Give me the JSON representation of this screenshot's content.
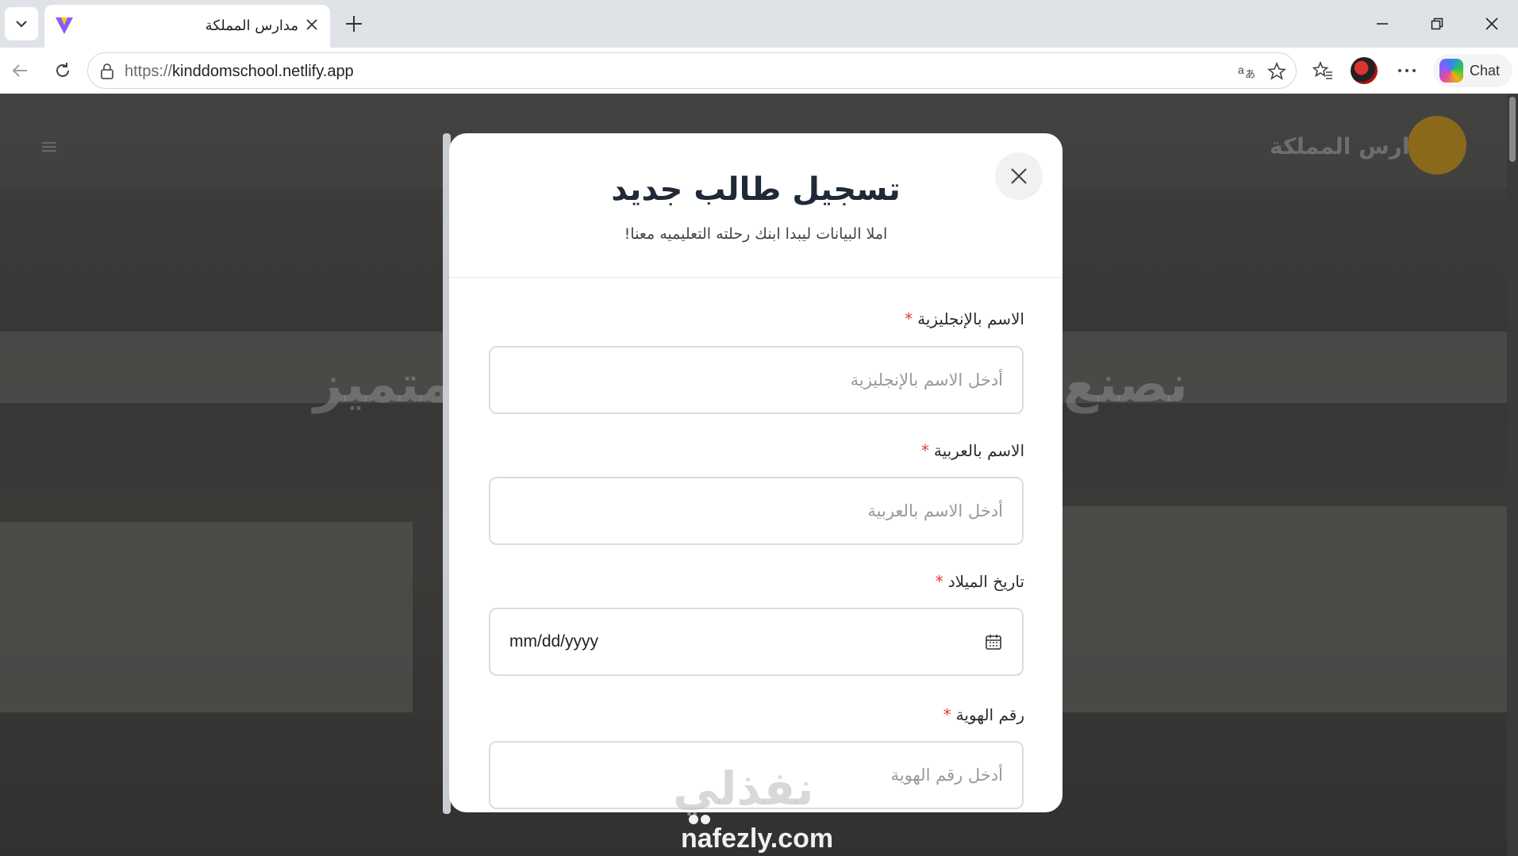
{
  "browser": {
    "tab_title": "مدارس المملكة",
    "url_protocol": "https://",
    "url_host": "kinddomschool.netlify.app",
    "chat_label": "Chat",
    "icons": {
      "tab_list": "chevron-down-icon",
      "favicon": "vite-favicon",
      "close_tab": "close-icon",
      "new_tab": "plus-icon",
      "back": "arrow-left-icon",
      "refresh": "refresh-icon",
      "lock": "lock-icon",
      "translate": "translate-icon",
      "favorite": "star-icon",
      "favorites_list": "favorites-icon",
      "more": "more-icon"
    }
  },
  "background": {
    "brand": "مدارس المملكة",
    "hero_right": "نصنع",
    "hero_left": "متميز"
  },
  "modal": {
    "title": "تسجيل طالب جديد",
    "subtitle": "املا البيانات ليبدا ابنك رحلته التعليميه معنا!",
    "fields": [
      {
        "label": "الاسم بالإنجليزية",
        "required_mark": "*",
        "placeholder": "أدخل الاسم بالإنجليزية"
      },
      {
        "label": "الاسم بالعربية",
        "required_mark": "*",
        "placeholder": "أدخل الاسم بالعربية"
      },
      {
        "label": "تاريخ الميلاد",
        "required_mark": "*",
        "value": "mm/dd/yyyy"
      },
      {
        "label": "رقم الهوية",
        "required_mark": "*",
        "placeholder": "أدخل رقم الهوية"
      }
    ]
  },
  "watermark": {
    "arabic": "نفذلي",
    "latin": "nafezly.com"
  },
  "colors": {
    "required": "#e23b3b",
    "title": "#1f2937",
    "overlay": "#3a3a3a"
  }
}
